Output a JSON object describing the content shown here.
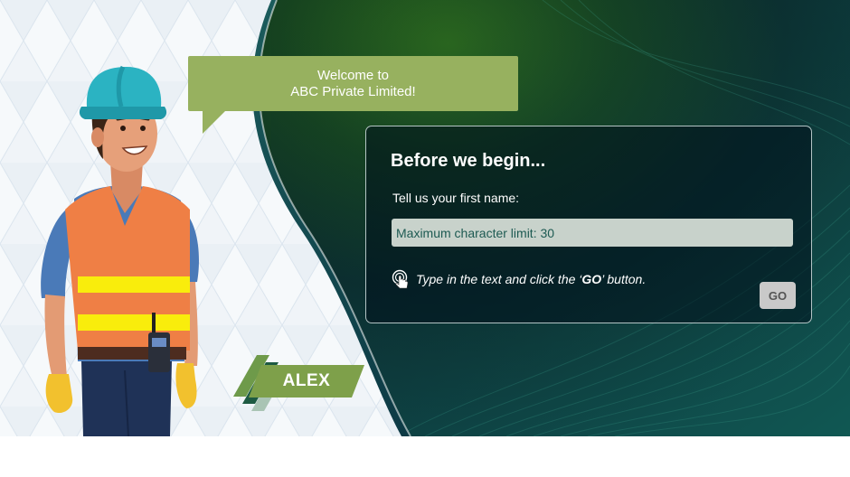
{
  "welcome": {
    "line1": "Welcome to",
    "line2": "ABC Private Limited!"
  },
  "character": {
    "name": "ALEX",
    "icon": "construction-worker-illustration"
  },
  "panel": {
    "title": "Before we begin...",
    "prompt": "Tell us your first name:",
    "input_placeholder": "Maximum character limit: 30",
    "input_value": "",
    "hint_prefix": "Type in the text and click the ‘",
    "hint_emphasis": "GO",
    "hint_suffix": "’ button.",
    "hint_icon": "tap-hand-icon",
    "go_label": "GO"
  },
  "colors": {
    "bubble": "#97b15f",
    "name_tag": "#7ea04a",
    "input_bg": "#c8d2cb",
    "input_text": "#1d5a52",
    "go_button": "#c9c9c9"
  }
}
